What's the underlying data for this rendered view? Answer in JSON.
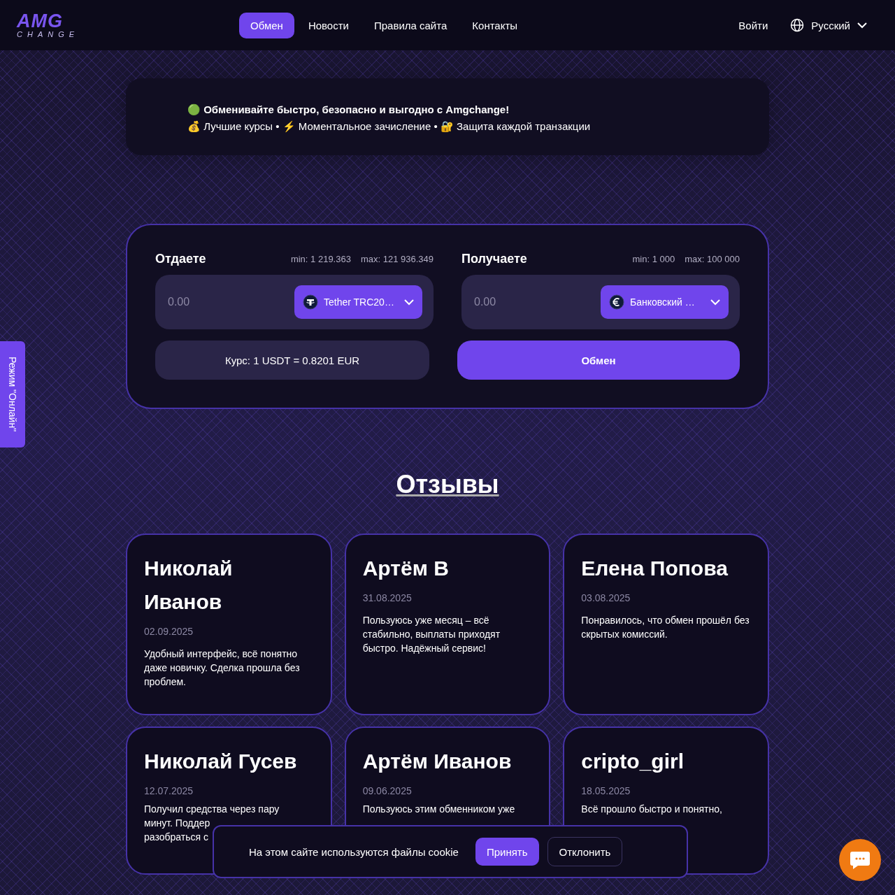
{
  "header": {
    "logo": {
      "top": "AMG",
      "bottom": "CHANGE"
    },
    "nav": [
      {
        "label": "Обмен",
        "selected": true
      },
      {
        "label": "Новости",
        "selected": false
      },
      {
        "label": "Правила сайта",
        "selected": false
      },
      {
        "label": "Контакты",
        "selected": false
      }
    ],
    "login": "Войти",
    "language": "Русский"
  },
  "promo": {
    "headline": "🟢 Обменивайте быстро, безопасно и выгодно с Amgchange!",
    "features": "💰 Лучшие курсы • ⚡ Моментальное зачисление • 🔐 Защита каждой транзакции"
  },
  "exchange": {
    "give": {
      "title": "Отдаете",
      "min": "min: 1 219.363",
      "max": "max: 121 936.349",
      "placeholder": "0.00",
      "currency": "Tether TRC20…"
    },
    "receive": {
      "title": "Получаете",
      "min": "min: 1 000",
      "max": "max: 100 000",
      "placeholder": "0.00",
      "currency": "Банковский …"
    },
    "rate": "Курс: 1 USDT = 0.8201 EUR",
    "submit": "Обмен"
  },
  "side_tab": "Режим \"Онлайн\"",
  "reviews": {
    "title": "Отзывы",
    "items": [
      {
        "name": "Николай Иванов",
        "date": "02.09.2025",
        "text": "Удобный интерфейс, всё понятно даже новичку. Сделка прошла без проблем."
      },
      {
        "name": "Артём В",
        "date": "31.08.2025",
        "text": "Пользуюсь уже месяц – всё стабильно, выплаты приходят быстро. Надёжный сервис!"
      },
      {
        "name": "Елена Попова",
        "date": "03.08.2025",
        "text": "Понравилось, что обмен прошёл без скрытых комиссий."
      },
      {
        "name": "Николай Гусев",
        "date": "12.07.2025",
        "text": "Получил средства через пару\nминут. Поддер\nразобраться с"
      },
      {
        "name": "Артём Иванов",
        "date": "09.06.2025",
        "text": "Пользуюсь этим обменником уже"
      },
      {
        "name": "cripto_girl",
        "date": "18.05.2025",
        "text": "Всё прошло быстро и понятно,"
      }
    ]
  },
  "cookie": {
    "message": "На этом сайте используются файлы cookie",
    "accept": "Принять",
    "decline": "Отклонить"
  }
}
